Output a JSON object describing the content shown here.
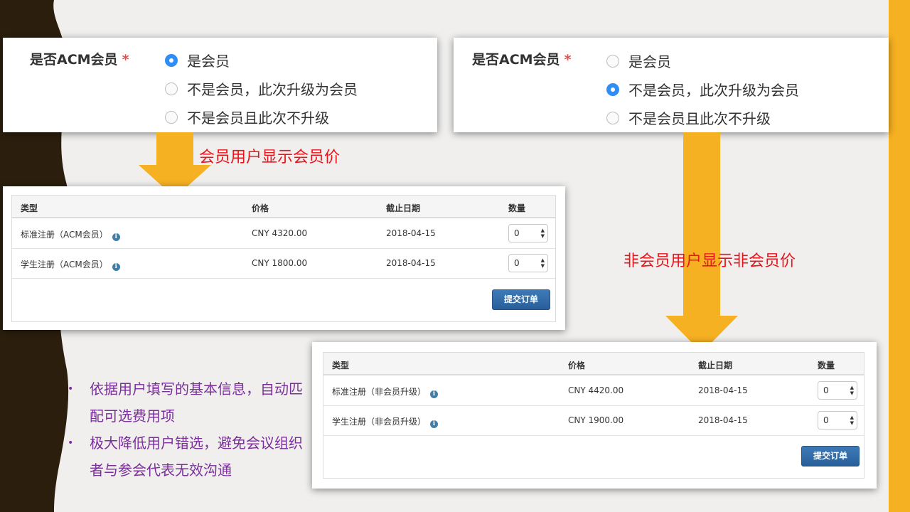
{
  "colors": {
    "accent": "#f6b122",
    "dark": "#2b1e0c",
    "label_red": "#e8151c",
    "bullet_purple": "#7a2f9a",
    "radio_blue": "#2f8ef5"
  },
  "member_form": {
    "label": "是否ACM会员",
    "required_mark": "*",
    "options": [
      "是会员",
      "不是会员，此次升级为会员",
      "不是会员且此次不升级"
    ],
    "selected_index": 0
  },
  "nonmember_form": {
    "label": "是否ACM会员",
    "required_mark": "*",
    "options": [
      "是会员",
      "不是会员，此次升级为会员",
      "不是会员且此次不升级"
    ],
    "selected_index": 1
  },
  "label_member": "会员用户显示会员价",
  "label_nonmember": "非会员用户显示非会员价",
  "member_table": {
    "headers": [
      "类型",
      "价格",
      "截止日期",
      "数量"
    ],
    "rows": [
      {
        "type": "标准注册（ACM会员）",
        "price": "CNY 4320.00",
        "deadline": "2018-04-15",
        "qty": "0"
      },
      {
        "type": "学生注册（ACM会员）",
        "price": "CNY 1800.00",
        "deadline": "2018-04-15",
        "qty": "0"
      }
    ],
    "submit": "提交订单",
    "info_icon": "info-icon"
  },
  "nonmember_table": {
    "headers": [
      "类型",
      "价格",
      "截止日期",
      "数量"
    ],
    "rows": [
      {
        "type": "标准注册（非会员升级）",
        "price": "CNY 4420.00",
        "deadline": "2018-04-15",
        "qty": "0"
      },
      {
        "type": "学生注册（非会员升级）",
        "price": "CNY 1900.00",
        "deadline": "2018-04-15",
        "qty": "0"
      }
    ],
    "submit": "提交订单",
    "info_icon": "info-icon"
  },
  "bullets": [
    "依据用户填写的基本信息，自动匹配可选费用项",
    "极大降低用户错选，避免会议组织者与参会代表无效沟通"
  ]
}
